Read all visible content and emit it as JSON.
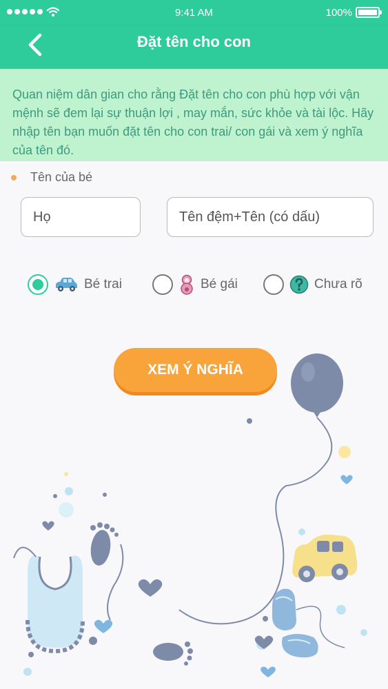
{
  "status_bar": {
    "time": "9:41 AM",
    "battery": "100%"
  },
  "nav": {
    "title": "Đặt tên cho con"
  },
  "intro": {
    "text": "Quan niệm dân gian cho rằng Đặt tên cho con phù hợp với vận mệnh sẽ đem lại sự thuận lợi , may mắn, sức khỏe và tài lộc. Hãy nhập tên bạn muốn đặt tên cho con trai/ con gái và xem ý nghĩa của tên đó."
  },
  "form": {
    "section_label": "Tên của bé",
    "ho_placeholder": "Họ",
    "ten_placeholder": "Tên đệm+Tên (có dấu)",
    "genders": [
      {
        "label": "Bé trai",
        "icon": "car-icon",
        "selected": true
      },
      {
        "label": "Bé gái",
        "icon": "doll-icon",
        "selected": false
      },
      {
        "label": "Chưa rõ",
        "icon": "question-icon",
        "selected": false
      }
    ],
    "submit_label": "XEM Ý NGHĨA"
  },
  "colors": {
    "primary": "#2ecc9a",
    "intro_bg": "#bff2cf",
    "intro_text": "#3d9a7f",
    "accent": "#f8a43a"
  }
}
